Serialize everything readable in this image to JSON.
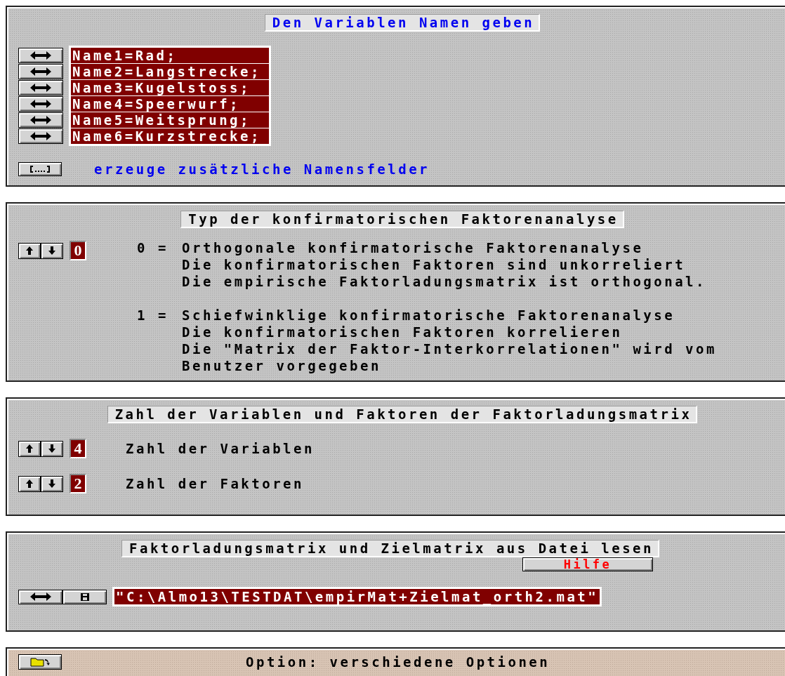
{
  "sections": [
    {
      "kind": "names",
      "title": "Den Variablen Namen geben",
      "names": [
        "Name1=Rad;",
        "Name2=Langstrecke;",
        "Name3=Kugelstoss;",
        "Name4=Speerwurf;",
        "Name5=Weitsprung;",
        "Name6=Kurzstrecke;"
      ],
      "add_label": "erzeuge zusätzliche Namensfelder"
    },
    {
      "kind": "type",
      "title": "Typ der konfirmatorischen Faktorenanalyse",
      "value": "0",
      "options": [
        {
          "code": "0 =",
          "lines": [
            "Orthogonale konfirmatorische Faktorenanalyse",
            "Die konfirmatorischen Faktoren sind unkorreliert",
            "Die empirische Faktorladungsmatrix ist orthogonal."
          ]
        },
        {
          "code": "1 =",
          "lines": [
            "Schiefwinklige konfirmatorische Faktorenanalyse",
            "Die konfirmatorischen Faktoren korrelieren",
            "Die \"Matrix der Faktor-Interkorrelationen\" wird vom",
            "Benutzer vorgegeben"
          ]
        }
      ]
    },
    {
      "kind": "counts",
      "title": "Zahl der Variablen und Faktoren der Faktorladungsmatrix",
      "rows": [
        {
          "value": "4",
          "label": "Zahl der Variablen"
        },
        {
          "value": "2",
          "label": "Zahl der Faktoren"
        }
      ]
    },
    {
      "kind": "file",
      "title": "Faktorladungsmatrix und Zielmatrix aus Datei lesen",
      "help": "Hilfe",
      "path": "\"C:\\Almo13\\TESTDAT\\empirMat+Zielmat_orth2.mat\""
    },
    {
      "kind": "option",
      "title": "Option: verschiedene Optionen"
    }
  ]
}
